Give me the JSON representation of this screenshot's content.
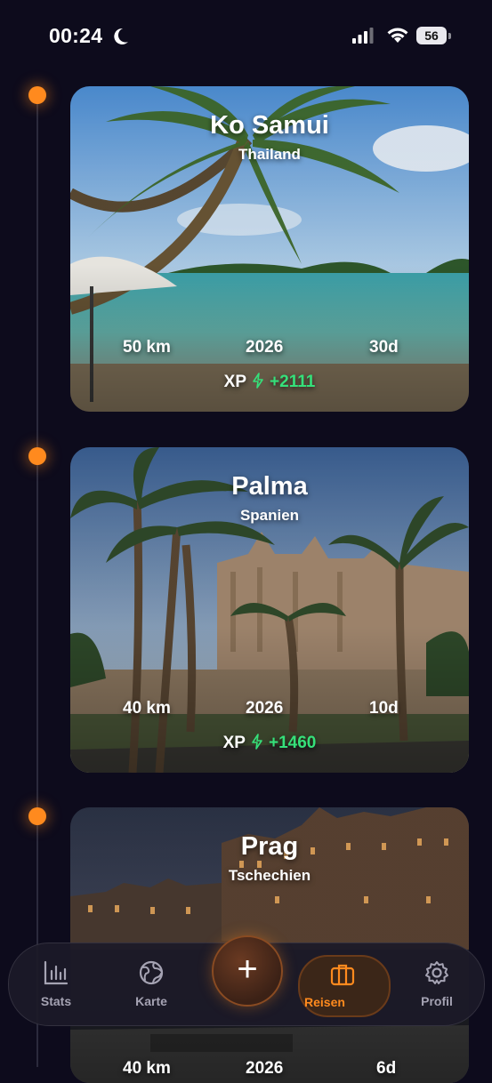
{
  "status_bar": {
    "time": "00:24",
    "battery": "56",
    "icons": [
      "moon-icon",
      "signal-icon",
      "wifi-icon",
      "battery-icon"
    ]
  },
  "trips": [
    {
      "title": "Ko Samui",
      "country": "Thailand",
      "distance": "50 km",
      "year": "2026",
      "duration": "30d",
      "xp_label": "XP",
      "xp_gain": "+2111"
    },
    {
      "title": "Palma",
      "country": "Spanien",
      "distance": "40 km",
      "year": "2026",
      "duration": "10d",
      "xp_label": "XP",
      "xp_gain": "+1460"
    },
    {
      "title": "Prag",
      "country": "Tschechien",
      "distance": "40 km",
      "year": "2026",
      "duration": "6d"
    }
  ],
  "nav": {
    "items": [
      {
        "label": "Stats",
        "icon": "bar-chart-icon"
      },
      {
        "label": "Karte",
        "icon": "globe-icon"
      },
      {
        "label": "Reisen",
        "icon": "suitcase-icon",
        "active": true
      },
      {
        "label": "Profil",
        "icon": "gear-icon"
      }
    ],
    "add_label": "+"
  },
  "colors": {
    "accent": "#ff8a1e",
    "xp_green": "#35e07a",
    "background": "#0d0b1c"
  }
}
